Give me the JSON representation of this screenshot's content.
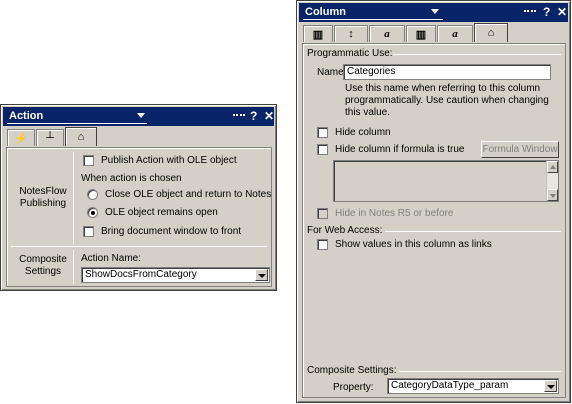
{
  "action_window": {
    "title": "Action",
    "tabs": [
      {
        "icon": "lightning-icon",
        "glyph": "⚡"
      },
      {
        "icon": "hide-when-icon",
        "glyph": "┴"
      },
      {
        "icon": "propeller-hat-icon",
        "glyph": "⌂"
      }
    ],
    "notesflow_label": "NotesFlow Publishing",
    "publish_ole_label": "Publish Action with OLE object",
    "when_chosen_label": "When action is chosen",
    "radio_close_label": "Close OLE object and return to Notes",
    "radio_remains_label": "OLE object remains open",
    "selected_radio": "OLE object remains open",
    "bring_doc_label": "Bring document window to front",
    "composite_label": "Composite Settings",
    "action_name_label": "Action Name:",
    "action_name_value": "ShowDocsFromCategory"
  },
  "column_window": {
    "title": "Column",
    "tabs": [
      {
        "icon": "column-info-icon",
        "glyph": "▥"
      },
      {
        "icon": "sort-icon",
        "glyph": "↕"
      },
      {
        "icon": "font-icon",
        "glyph": "a"
      },
      {
        "icon": "numbers-icon",
        "glyph": "▥"
      },
      {
        "icon": "title-font-icon",
        "glyph": "a"
      },
      {
        "icon": "propeller-hat-icon",
        "glyph": "⌂"
      }
    ],
    "programmatic_use_label": "Programmatic Use:",
    "name_label": "Name:",
    "name_value": "Categories",
    "note": "Use this name when referring to this column programmatically.  Use caution when changing this value.",
    "hide_column_label": "Hide column",
    "hide_if_formula_label": "Hide column if formula is true",
    "formula_window_label": "Formula Window",
    "hide_r5_label": "Hide in Notes R5 or before",
    "web_access_label": "For Web Access:",
    "show_as_links_label": "Show values in this column as links",
    "composite_label": "Composite Settings:",
    "property_label": "Property:",
    "property_value": "CategoryDataType_param"
  }
}
